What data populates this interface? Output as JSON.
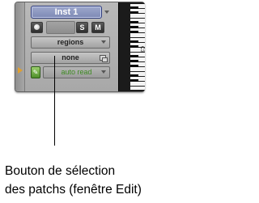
{
  "track": {
    "name": "Inst 1",
    "solo_label": "S",
    "mute_label": "M",
    "view_selector": "regions",
    "patch_selector": "none",
    "automation_mode": "auto read",
    "keyboard_octave_label": "C3"
  },
  "callout": {
    "line1": "Bouton de sélection",
    "line2": "des patchs (fenêtre Edit)"
  },
  "colors": {
    "name_field": "#8d97c2",
    "automation_text": "#3e8a22",
    "record_dot": "#ffffff"
  }
}
